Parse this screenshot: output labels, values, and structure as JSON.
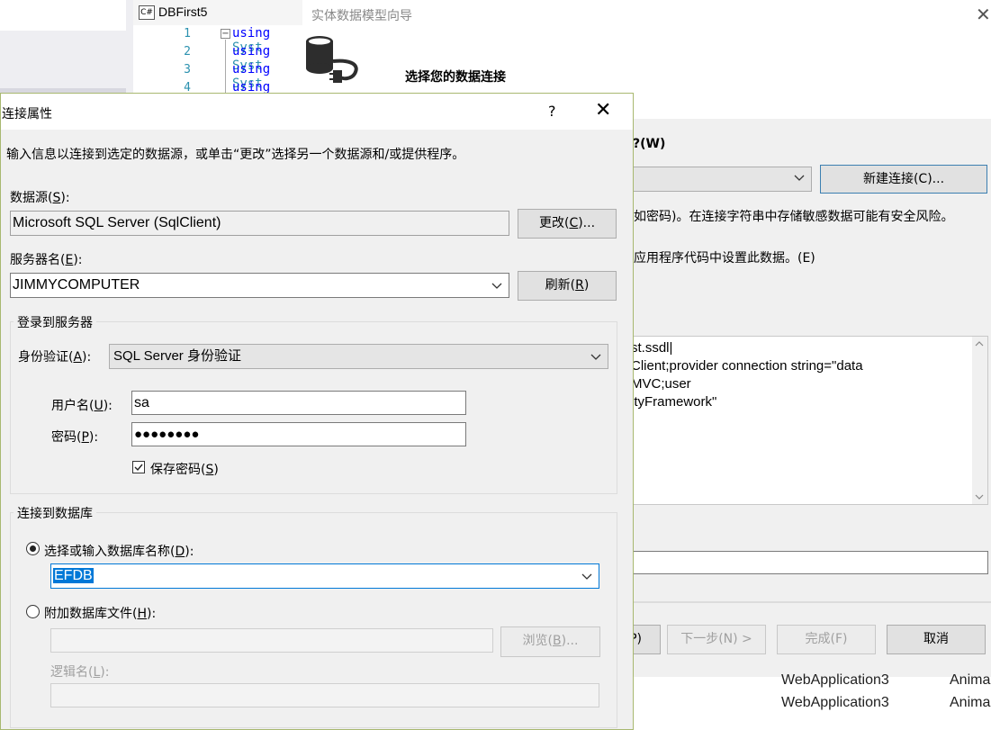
{
  "ide": {
    "tab_title": "DBFirst5",
    "tab_badge": "C#",
    "line_numbers": [
      "1",
      "2",
      "3",
      "4"
    ],
    "code_keyword": "using",
    "code_rest": "Syst"
  },
  "wizard": {
    "title": "实体数据模型向导",
    "subtitle": "选择您的数据连接",
    "question": "?(W)",
    "new_connection": "新建连接(C)...",
    "security_text": "如密码)。在连接字符串中存储敏感数据可能有安全风险。",
    "set_text": "应用程序代码中设置此数据。(E)",
    "conn_lines": [
      "st.ssdl|",
      "Client;provider connection string=\"data",
      "MVC;user",
      "ityFramework\""
    ],
    "buttons": {
      "prev": "P)",
      "next": "下一步(N) >",
      "finish": "完成(F)",
      "cancel": "取消"
    },
    "bottom_rows": [
      {
        "name": "WebApplication3",
        "type": "Anima"
      },
      {
        "name": "WebApplication3",
        "type": "Anima"
      }
    ]
  },
  "dialog": {
    "title": "连接属性",
    "help": "?",
    "description": "输入信息以连接到选定的数据源，或单击“更改”选择另一个数据源和/或提供程序。",
    "data_source": {
      "label_pre": "数据源(",
      "label_key": "S",
      "label_post": "):",
      "value": "Microsoft SQL Server (SqlClient)",
      "change_pre": "更改(",
      "change_key": "C",
      "change_post": ")..."
    },
    "server": {
      "label_pre": "服务器名(",
      "label_key": "E",
      "label_post": "):",
      "value": "JIMMYCOMPUTER",
      "refresh_pre": "刷新(",
      "refresh_key": "R",
      "refresh_post": ")"
    },
    "login": {
      "group_title": "登录到服务器",
      "auth_label_pre": "身份验证(",
      "auth_label_key": "A",
      "auth_label_post": "):",
      "auth_value": "SQL Server 身份验证",
      "user_label_pre": "用户名(",
      "user_label_key": "U",
      "user_label_post": "):",
      "user_value": "sa",
      "password_label_pre": "密码(",
      "password_label_key": "P",
      "password_label_post": "):",
      "password_value": "●●●●●●●●",
      "save_pre": "保存密码(",
      "save_key": "S",
      "save_post": ")"
    },
    "database": {
      "group_title": "连接到数据库",
      "select_pre": "选择或输入数据库名称(",
      "select_key": "D",
      "select_post": "):",
      "db_value": "EFDB",
      "attach_pre": "附加数据库文件(",
      "attach_key": "H",
      "attach_post": "):",
      "browse_pre": "浏览(",
      "browse_key": "B",
      "browse_post": ")...",
      "logical_pre": "逻辑名(",
      "logical_key": "L",
      "logical_post": "):"
    }
  }
}
